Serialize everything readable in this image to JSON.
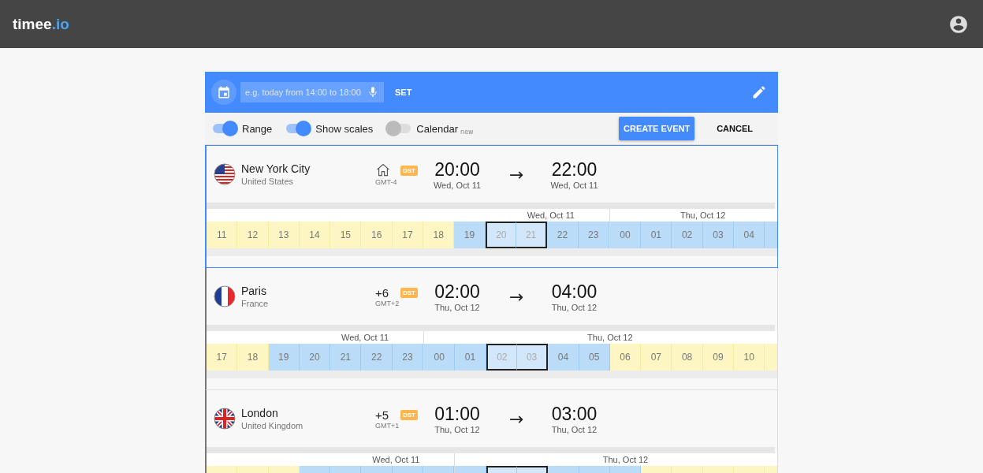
{
  "app_bar": {
    "logo_name": "timee",
    "logo_suffix": ".io"
  },
  "event_bar": {
    "placeholder": "e.g. today from 14:00 to 18:00",
    "set_label": "SET"
  },
  "options": [
    {
      "label": "Range",
      "on": true
    },
    {
      "label": "Show scales",
      "on": true
    },
    {
      "label": "Calendar",
      "note": "new",
      "on": false
    }
  ],
  "actions": [
    {
      "label": "CREATE EVENT",
      "kind": "primary"
    },
    {
      "label": "CANCEL",
      "kind": "flat"
    }
  ],
  "cities": [
    {
      "name": "New York City",
      "country": "United States",
      "flag": {
        "kind": "us"
      },
      "selected": true,
      "home": true,
      "gmt": "GMT-4",
      "dst": "DST",
      "start_time": "20:00",
      "start_date": "Wed, Oct 11",
      "arrow": "→",
      "end_time": "22:00",
      "end_date": "Wed, Oct 11",
      "days": [
        {
          "label": "Wed, Oct 11",
          "hours": [
            {
              "hour": "11",
              "daytime": true,
              "selected": false
            },
            {
              "hour": "12",
              "daytime": true,
              "selected": false
            },
            {
              "hour": "13",
              "daytime": true,
              "selected": false
            },
            {
              "hour": "14",
              "daytime": true,
              "selected": false
            },
            {
              "hour": "15",
              "daytime": true,
              "selected": false
            },
            {
              "hour": "16",
              "daytime": true,
              "selected": false
            },
            {
              "hour": "17",
              "daytime": true,
              "selected": false
            },
            {
              "hour": "18",
              "daytime": true,
              "selected": false
            },
            {
              "hour": "19",
              "daytime": false,
              "selected": false
            },
            {
              "hour": "20",
              "daytime": false,
              "selected": true
            },
            {
              "hour": "21",
              "daytime": false,
              "selected": true
            },
            {
              "hour": "22",
              "daytime": false,
              "selected": false
            },
            {
              "hour": "23",
              "daytime": false,
              "selected": false
            }
          ]
        },
        {
          "label": "Thu, Oct 12",
          "hours": [
            {
              "hour": "00",
              "daytime": false,
              "selected": false
            },
            {
              "hour": "01",
              "daytime": false,
              "selected": false
            },
            {
              "hour": "02",
              "daytime": false,
              "selected": false
            },
            {
              "hour": "03",
              "daytime": false,
              "selected": false
            },
            {
              "hour": "04",
              "daytime": false,
              "selected": false
            },
            {
              "daytime": false,
              "selected": false
            }
          ]
        }
      ]
    },
    {
      "name": "Paris",
      "country": "France",
      "flag": {
        "kind": "fr"
      },
      "selected": false,
      "home": false,
      "offset": "+6",
      "gmt": "GMT+2",
      "dst": "DST",
      "start_time": "02:00",
      "start_date": "Thu, Oct 12",
      "arrow": "→",
      "end_time": "04:00",
      "end_date": "Thu, Oct 12",
      "days": [
        {
          "label": "Wed, Oct 11",
          "hours": [
            {
              "hour": "17",
              "daytime": true,
              "selected": false
            },
            {
              "hour": "18",
              "daytime": true,
              "selected": false
            },
            {
              "hour": "19",
              "daytime": false,
              "selected": false
            },
            {
              "hour": "20",
              "daytime": false,
              "selected": false
            },
            {
              "hour": "21",
              "daytime": false,
              "selected": false
            },
            {
              "hour": "22",
              "daytime": false,
              "selected": false
            },
            {
              "hour": "23",
              "daytime": false,
              "selected": false
            }
          ]
        },
        {
          "label": "Thu, Oct 12",
          "hours": [
            {
              "hour": "00",
              "daytime": false,
              "selected": false
            },
            {
              "hour": "01",
              "daytime": false,
              "selected": false
            },
            {
              "hour": "02",
              "daytime": false,
              "selected": true
            },
            {
              "hour": "03",
              "daytime": false,
              "selected": true
            },
            {
              "hour": "04",
              "daytime": false,
              "selected": false
            },
            {
              "hour": "05",
              "daytime": false,
              "selected": false
            },
            {
              "hour": "06",
              "daytime": true,
              "selected": false
            },
            {
              "hour": "07",
              "daytime": true,
              "selected": false
            },
            {
              "hour": "08",
              "daytime": true,
              "selected": false
            },
            {
              "hour": "09",
              "daytime": true,
              "selected": false
            },
            {
              "hour": "10",
              "daytime": true,
              "selected": false
            },
            {
              "daytime": true,
              "selected": false
            }
          ]
        }
      ]
    },
    {
      "name": "London",
      "country": "United Kingdom",
      "flag": {
        "kind": "gb"
      },
      "selected": false,
      "home": false,
      "offset": "+5",
      "gmt": "GMT+1",
      "dst": "DST",
      "start_time": "01:00",
      "start_date": "Thu, Oct 12",
      "arrow": "→",
      "end_time": "03:00",
      "end_date": "Thu, Oct 12",
      "days": [
        {
          "label": "Wed, Oct 11",
          "hours": [
            {
              "daytime": true,
              "selected": false
            },
            {
              "daytime": true,
              "selected": false
            },
            {
              "daytime": true,
              "selected": false
            },
            {
              "daytime": false,
              "selected": false
            },
            {
              "daytime": false,
              "selected": false
            },
            {
              "daytime": false,
              "selected": false
            },
            {
              "daytime": false,
              "selected": false
            },
            {
              "daytime": false,
              "selected": false
            }
          ]
        },
        {
          "label": "Thu, Oct 12",
          "hours": [
            {
              "daytime": false,
              "selected": false
            },
            {
              "daytime": false,
              "selected": true
            },
            {
              "daytime": false,
              "selected": true
            },
            {
              "daytime": false,
              "selected": false
            },
            {
              "daytime": false,
              "selected": false
            },
            {
              "daytime": false,
              "selected": false
            },
            {
              "daytime": true,
              "selected": false
            },
            {
              "daytime": true,
              "selected": false
            },
            {
              "daytime": true,
              "selected": false
            },
            {
              "daytime": true,
              "selected": false
            },
            {
              "daytime": true,
              "selected": false
            }
          ]
        }
      ]
    }
  ]
}
